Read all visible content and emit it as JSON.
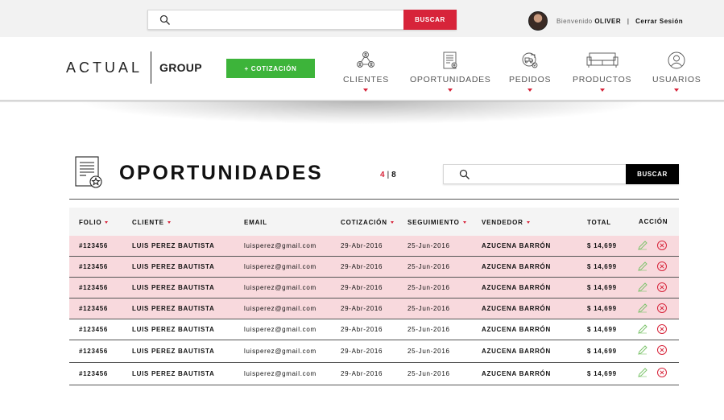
{
  "topbar": {
    "search": {
      "placeholder": "",
      "button_label": "BUSCAR"
    },
    "user": {
      "greeting": "Bienvenido",
      "name": "OLIVER",
      "separator": "|",
      "logout_label": "Cerrar Sesión"
    }
  },
  "header": {
    "logo": {
      "primary": "ACTUAL",
      "secondary": "GROUP"
    },
    "new_quote_button": "+ COTIZACIÓN",
    "nav": [
      {
        "label": "CLIENTES",
        "icon": "users-network-icon"
      },
      {
        "label": "OPORTUNIDADES",
        "icon": "document-gear-icon"
      },
      {
        "label": "PEDIDOS",
        "icon": "orders-circle-icon"
      },
      {
        "label": "PRODUCTOS",
        "icon": "sofa-icon"
      },
      {
        "label": "USUARIOS",
        "icon": "user-circle-icon"
      }
    ]
  },
  "page": {
    "title": "OPORTUNIDADES",
    "title_icon": "document-star-icon",
    "pager": {
      "current": "4",
      "separator": "|",
      "total": "8"
    },
    "search": {
      "placeholder": "",
      "button_label": "BUSCAR"
    }
  },
  "table": {
    "columns": [
      "FOLIO",
      "CLIENTE",
      "EMAIL",
      "COTIZACIÓN",
      "SEGUIMIENTO",
      "VENDEDOR",
      "TOTAL",
      "ACCIÓN"
    ],
    "rows": [
      {
        "folio": "#123456",
        "cliente": "LUIS PEREZ BAUTISTA",
        "email": "luisperez@gmail.com",
        "cotizacion": "29-Abr-2016",
        "seguimiento": "25-Jun-2016",
        "vendedor": "AZUCENA BARRÓN",
        "total": "$ 14,699",
        "highlighted": true
      },
      {
        "folio": "#123456",
        "cliente": "LUIS PEREZ BAUTISTA",
        "email": "luisperez@gmail.com",
        "cotizacion": "29-Abr-2016",
        "seguimiento": "25-Jun-2016",
        "vendedor": "AZUCENA BARRÓN",
        "total": "$ 14,699",
        "highlighted": true
      },
      {
        "folio": "#123456",
        "cliente": "LUIS PEREZ BAUTISTA",
        "email": "luisperez@gmail.com",
        "cotizacion": "29-Abr-2016",
        "seguimiento": "25-Jun-2016",
        "vendedor": "AZUCENA BARRÓN",
        "total": "$ 14,699",
        "highlighted": true
      },
      {
        "folio": "#123456",
        "cliente": "LUIS PEREZ BAUTISTA",
        "email": "luisperez@gmail.com",
        "cotizacion": "29-Abr-2016",
        "seguimiento": "25-Jun-2016",
        "vendedor": "AZUCENA BARRÓN",
        "total": "$ 14,699",
        "highlighted": true
      },
      {
        "folio": "#123456",
        "cliente": "LUIS PEREZ BAUTISTA",
        "email": "luisperez@gmail.com",
        "cotizacion": "29-Abr-2016",
        "seguimiento": "25-Jun-2016",
        "vendedor": "AZUCENA BARRÓN",
        "total": "$ 14,699",
        "highlighted": false
      },
      {
        "folio": "#123456",
        "cliente": "LUIS PEREZ BAUTISTA",
        "email": "luisperez@gmail.com",
        "cotizacion": "29-Abr-2016",
        "seguimiento": "25-Jun-2016",
        "vendedor": "AZUCENA BARRÓN",
        "total": "$ 14,699",
        "highlighted": false
      },
      {
        "folio": "#123456",
        "cliente": "LUIS PEREZ BAUTISTA",
        "email": "luisperez@gmail.com",
        "cotizacion": "29-Abr-2016",
        "seguimiento": "25-Jun-2016",
        "vendedor": "AZUCENA BARRÓN",
        "total": "$ 14,699",
        "highlighted": false
      }
    ],
    "row_actions": [
      "edit-pencil-icon",
      "delete-x-icon"
    ]
  },
  "colors": {
    "accent_red": "#d7243a",
    "accent_green": "#3db43a",
    "highlight_row": "#f8d9dd",
    "edit_icon": "#7cc36b",
    "delete_icon": "#d7243a"
  }
}
